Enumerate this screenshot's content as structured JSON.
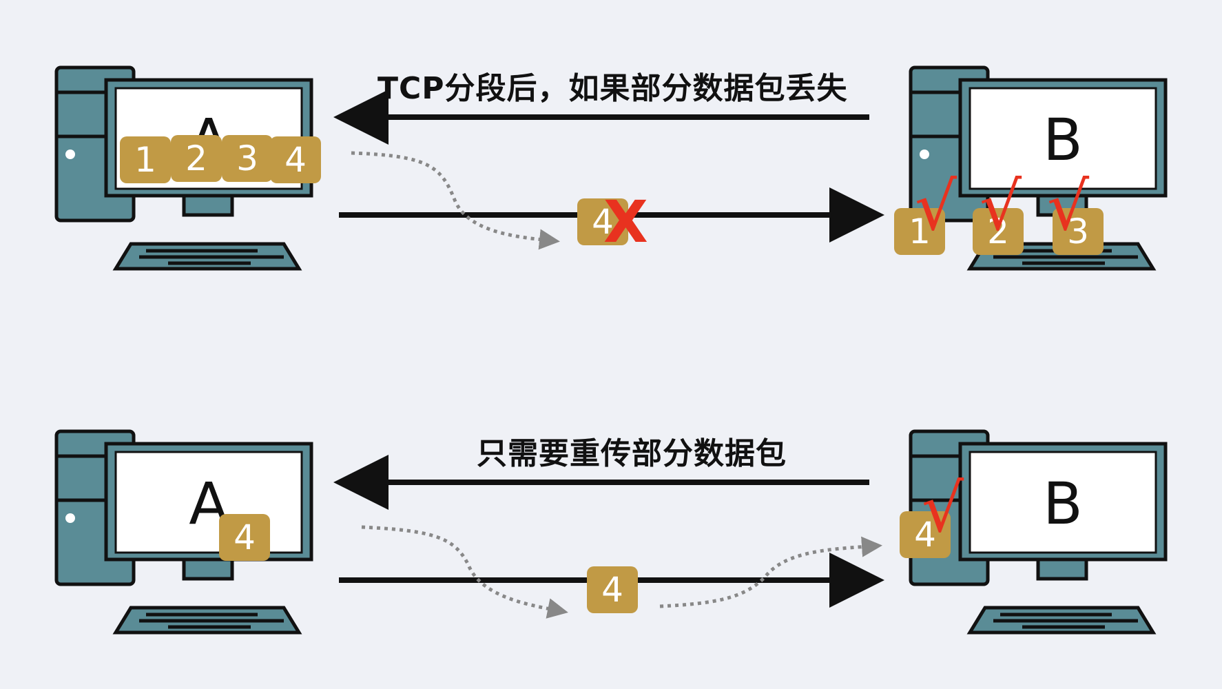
{
  "colors": {
    "background": "#eff1f6",
    "tower": "#5a8c96",
    "screen_frame": "#5a8c96",
    "screen": "#ffffff",
    "outline": "#111111",
    "packet": "#c19a45",
    "packet_text": "#ffffff",
    "mark": "#e8321f",
    "dashed_path": "#888888"
  },
  "top": {
    "caption": "TCP分段后，如果部分数据包丢失",
    "host_a_label": "A",
    "host_b_label": "B",
    "sender_packets": [
      "1",
      "2",
      "3",
      "4"
    ],
    "lost_packet": "4",
    "lost_mark": "X",
    "received_packets": [
      "1",
      "2",
      "3"
    ],
    "received_mark": "√"
  },
  "bottom": {
    "caption": "只需要重传部分数据包",
    "host_a_label": "A",
    "host_b_label": "B",
    "sender_packet": "4",
    "in_transit_packet": "4",
    "received_packet": "4",
    "received_mark": "√"
  }
}
